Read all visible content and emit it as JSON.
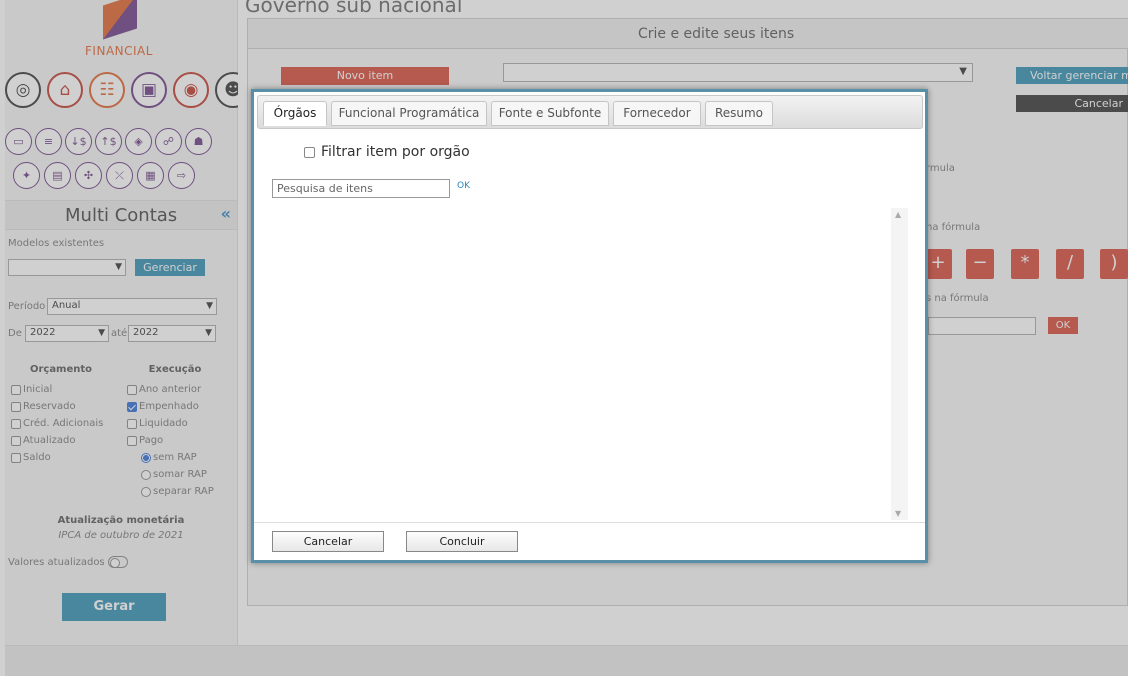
{
  "app": {
    "logo_text": "FINANCIAL",
    "page_heading": "Governo sub nacional",
    "sidebar": {
      "title": "Multi Contas",
      "collapse_icon": "double-chevron-left-icon",
      "models_label": "Modelos existentes",
      "manage_label": "Gerenciar",
      "period_label": "Período",
      "period_value": "Anual",
      "from_label": "De",
      "from_value": "2022",
      "to_label": "até",
      "to_value": "2022",
      "budget_heading": "Orçamento",
      "budget_items": [
        {
          "label": "Inicial",
          "checked": false
        },
        {
          "label": "Reservado",
          "checked": false
        },
        {
          "label": "Créd. Adicionais",
          "checked": false
        },
        {
          "label": "Atualizado",
          "checked": false
        },
        {
          "label": "Saldo",
          "checked": false
        }
      ],
      "execution_heading": "Execução",
      "execution_items": [
        {
          "label": "Ano anterior",
          "checked": false
        },
        {
          "label": "Empenhado",
          "checked": true
        },
        {
          "label": "Liquidado",
          "checked": false
        },
        {
          "label": "Pago",
          "checked": false
        }
      ],
      "rap_options": [
        {
          "label": "sem RAP",
          "selected": true
        },
        {
          "label": "somar RAP",
          "selected": false
        },
        {
          "label": "separar RAP",
          "selected": false
        }
      ],
      "monetary_heading": "Atualização monetária",
      "monetary_sub": "IPCA de outubro de 2021",
      "updated_values_label": "Valores atualizados",
      "generate_label": "Gerar"
    },
    "editor": {
      "title": "Crie e edite seus itens",
      "new_item_label": "Novo item",
      "back_label": "Voltar gerenciar m",
      "cancel_label": "Cancelar",
      "formula_label_1": "rmula",
      "formula_label_2": "na fórmula",
      "formula_label_3": "s na fórmula",
      "operators": [
        "+",
        "−",
        "*",
        "/",
        ")"
      ],
      "ok_label": "OK"
    }
  },
  "modal": {
    "tabs": [
      {
        "label": "Órgãos",
        "active": true
      },
      {
        "label": "Funcional Programática",
        "active": false
      },
      {
        "label": "Fonte e Subfonte",
        "active": false
      },
      {
        "label": "Fornecedor",
        "active": false
      },
      {
        "label": "Resumo",
        "active": false
      }
    ],
    "filter_label": "Filtrar item por orgão",
    "filter_checked": false,
    "search_placeholder": "Pesquisa de itens",
    "search_value": "",
    "ok_label": "OK",
    "cancel_label": "Cancelar",
    "confirm_label": "Concluir"
  }
}
